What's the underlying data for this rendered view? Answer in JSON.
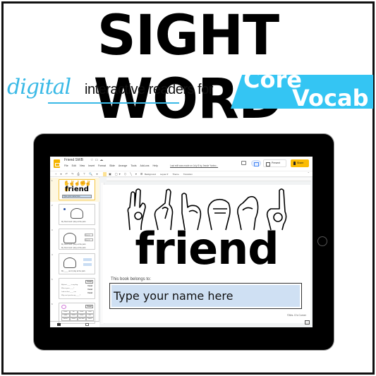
{
  "promo": {
    "title": "SIGHT WORD",
    "tag_script": "digital",
    "tag_text": "interactive readers for",
    "badge_line1": "Core",
    "badge_line2": "Vocab",
    "colors": {
      "accent": "#34c5f3",
      "script": "#39b9e6",
      "text": "#000000"
    }
  },
  "app": {
    "doc_title": "Friend SWB",
    "header_icons": [
      "star-icon",
      "move-to-folder-icon",
      "cloud-status-icon"
    ],
    "menu": [
      "File",
      "Edit",
      "View",
      "Insert",
      "Format",
      "Slide",
      "Arrange",
      "Tools",
      "Add-ons",
      "Help"
    ],
    "last_edit": "Last edit was made on July 8 by Jessie Yarbro...",
    "present_label": "Present",
    "share_label": "Share",
    "toolbar_icons": "+ ▾ ↶ ↷ ⎙ ⊤  🔍 ▾",
    "toolbar_tools": "▣ ▢▾ ⬡ ╲ ▾ ⊞",
    "toolbar_buttons": [
      "Background",
      "Layout ▾",
      "Theme",
      "Transition"
    ],
    "colors": {
      "share": "#fbbc04",
      "logo": "#f4b400",
      "selected_slide": "#f4c542",
      "name_field": "#cfe0f3"
    }
  },
  "sidebar": {
    "slides": [
      {
        "num": "1",
        "hands": "✋✌☝✊✌☝",
        "word": "friend",
        "name": "Type your name here",
        "active": true
      },
      {
        "num": "2",
        "text": "My friend and I play at the park.",
        "dots": "● ● ● ● ● ● ●"
      },
      {
        "num": "3",
        "box1": "friend",
        "box2": "friend",
        "text1": "My friend and I play at the park.",
        "text2": "My friend and I play at the park."
      },
      {
        "num": "4",
        "text": "My ____ and I play at the park."
      },
      {
        "num": "5",
        "tag": "friend",
        "rows": [
          "My best ____ is my dog.",
          "Who is your ____?",
          "Look at that ____ run.",
          "Why can't you be my ____?"
        ],
        "tags": [
          "friend",
          "friend",
          "friend",
          "friend"
        ]
      },
      {
        "num": "6",
        "tag": "friend",
        "grid": [
          "friend",
          "fun",
          "friend",
          "cried",
          "under",
          "friend",
          "friend",
          "ride",
          "further",
          "friend",
          "free time",
          "friend"
        ]
      }
    ]
  },
  "slide": {
    "word": "friend",
    "belongs_label": "This book belongs to:",
    "name_placeholder": "Type your name here",
    "credit": "©Mrs. D's Corner",
    "sign_letters": [
      "F",
      "R",
      "I",
      "E",
      "N",
      "D"
    ]
  }
}
